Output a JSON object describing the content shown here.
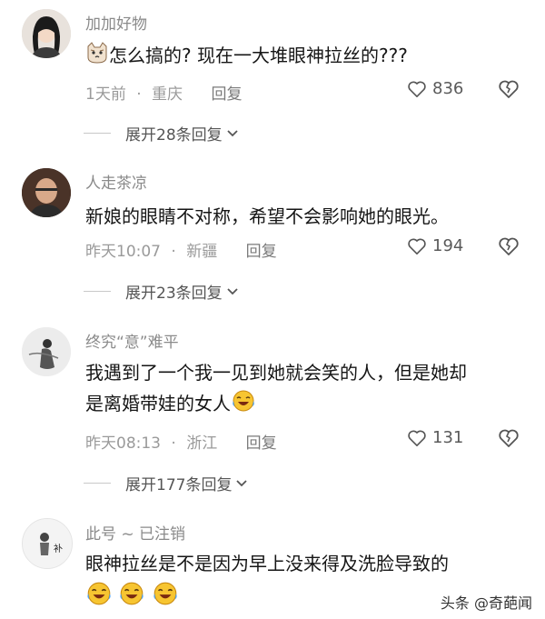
{
  "comments": [
    {
      "username": "加加好物",
      "text": "怎么搞的? 现在一大堆眼神拉丝的???",
      "time": "1天前",
      "location": "重庆",
      "reply_label": "回复",
      "likes": "836",
      "expand_label": "展开28条回复"
    },
    {
      "username": "人走茶凉",
      "text": "新娘的眼睛不对称，希望不会影响她的眼光。",
      "time": "昨天10:07",
      "location": "新疆",
      "reply_label": "回复",
      "likes": "194",
      "expand_label": "展开23条回复"
    },
    {
      "username": "终究“意”难平",
      "text_line1": "我遇到了一个我一见到她就会笑的人，但是她却",
      "text_line2": "是离婚带娃的女人",
      "time": "昨天08:13",
      "location": "浙江",
      "reply_label": "回复",
      "likes": "131",
      "expand_label": "展开177条回复"
    },
    {
      "username": "此号 ~ 已注销",
      "text": "眼神拉丝是不是因为早上没来得及洗脸导致的",
      "avatar_text": "补"
    }
  ],
  "separator": "·",
  "watermark": "头条 @奇葩闻",
  "icons": {
    "like": "heart-outline-icon",
    "dislike": "broken-heart-icon",
    "expand": "chevron-down-icon",
    "emoji": "laughing-crying-emoji"
  }
}
